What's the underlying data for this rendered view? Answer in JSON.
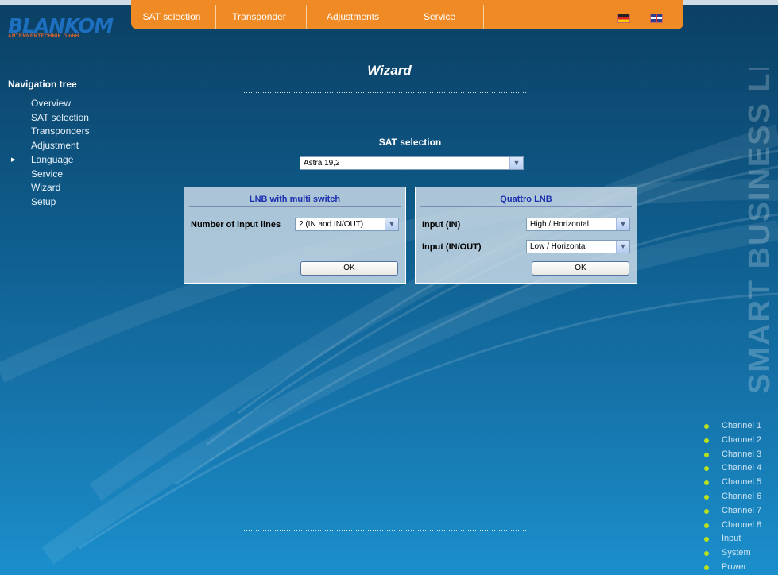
{
  "brand": {
    "name": "BLANKOM",
    "sub": "ANTENNENTECHNIK GmbH",
    "side_text": "SMART BUSINESS LINE"
  },
  "topnav": {
    "tabs": [
      "SAT selection",
      "Transponder",
      "Adjustments",
      "Service"
    ]
  },
  "navigation": {
    "title": "Navigation tree",
    "items": [
      "Overview",
      "SAT selection",
      "Transponders",
      "Adjustment",
      "Language",
      "Service",
      "Wizard",
      "Setup"
    ]
  },
  "page": {
    "title": "Wizard"
  },
  "sat_selection": {
    "label": "SAT selection",
    "value": "Astra 19,2"
  },
  "lnb_multi": {
    "title": "LNB with multi switch",
    "input_lines_label": "Number of input lines",
    "input_lines_value": "2 (IN and IN/OUT)",
    "ok_label": "OK"
  },
  "quattro": {
    "title": "Quattro LNB",
    "input_in_label": "Input (IN)",
    "input_in_value": "High / Horizontal",
    "input_inout_label": "Input (IN/OUT)",
    "input_inout_value": "Low / Horizontal",
    "ok_label": "OK"
  },
  "status": {
    "items": [
      "Channel 1",
      "Channel 2",
      "Channel 3",
      "Channel 4",
      "Channel 5",
      "Channel 6",
      "Channel 7",
      "Channel 8",
      "Input",
      "System",
      "Power"
    ],
    "led_color": "#b9e01c"
  }
}
